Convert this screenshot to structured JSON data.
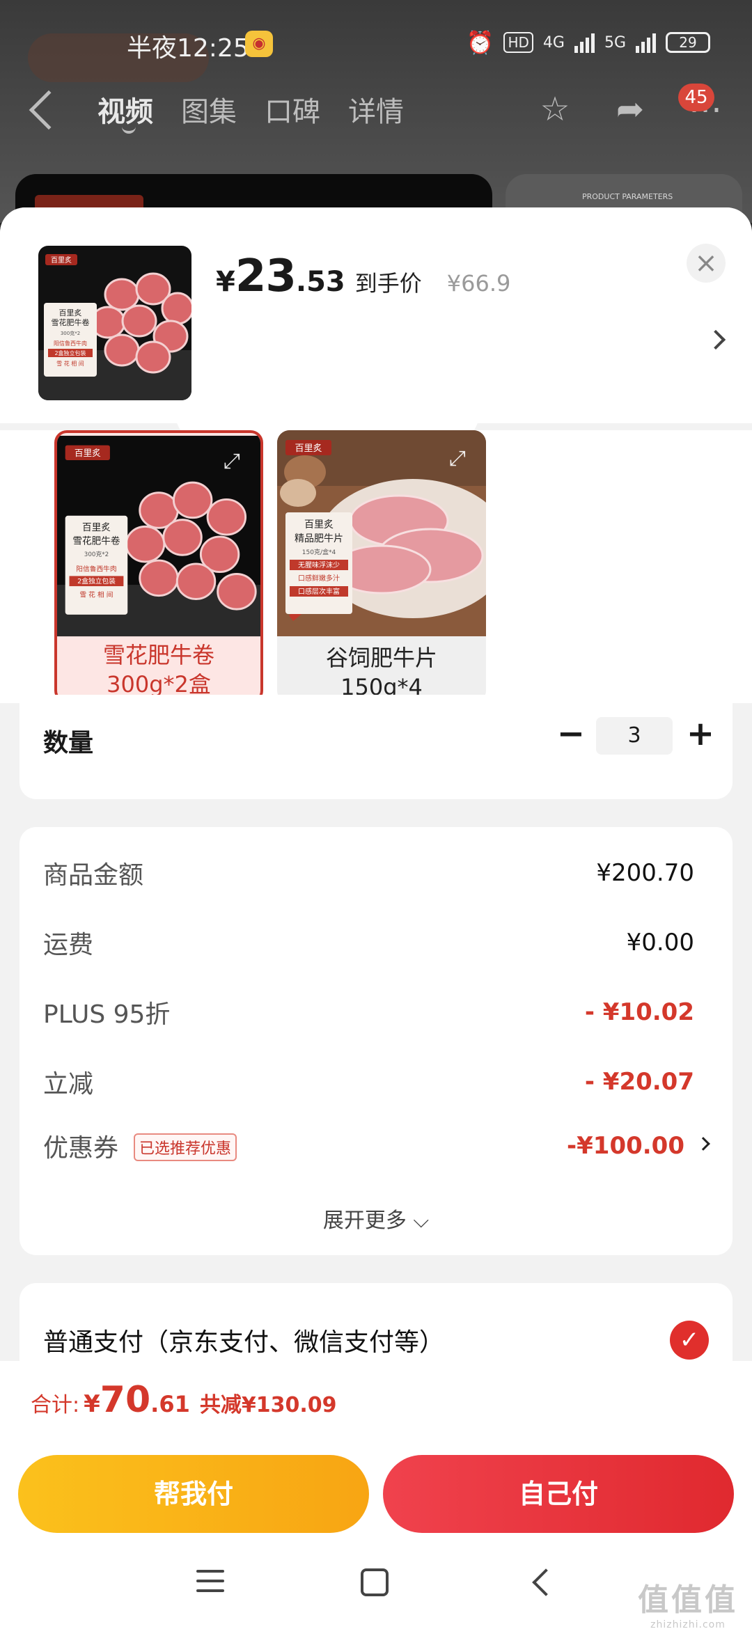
{
  "status_bar": {
    "time": "半夜12:25",
    "network_4g": "4G",
    "network_5g": "5G",
    "battery": "29",
    "hd": "HD"
  },
  "nav": {
    "tabs": [
      "视频",
      "图集",
      "口碑",
      "详情"
    ],
    "badge_count": "45"
  },
  "background": {
    "params_label": "PRODUCT PARAMETERS"
  },
  "sheet": {
    "price_symbol": "¥",
    "price_int": "23",
    "price_dec": ".53",
    "price_label": "到手价",
    "original_price": "¥66.9",
    "close_label": "×"
  },
  "thumbnail": {
    "brand": "百里炙",
    "name": "雪花肥牛卷",
    "spec": "300克*2",
    "tags": [
      "阳信鲁西牛肉",
      "2盒独立包装",
      "雪 花 相 间"
    ]
  },
  "variants": [
    {
      "line1": "雪花肥牛卷",
      "line2": "300g*2盒",
      "selected": true,
      "brand": "百里炙",
      "pack_name": "百里炙\n雪花肥牛卷",
      "pack_spec": "300克*2",
      "pack_tags": [
        "阳信鲁西牛肉",
        "2盒独立包装",
        "雪 花 相 间"
      ]
    },
    {
      "line1": "谷饲肥牛片",
      "line2": "150g*4",
      "selected": false,
      "brand": "百里炙",
      "pack_name": "百里炙\n精品肥牛片",
      "pack_spec": "150克/盒*4",
      "pack_tags": [
        "无腥味浮沫少",
        "口感鲜嫩多汁",
        "口感层次丰富"
      ]
    }
  ],
  "quantity": {
    "label": "数量",
    "value": "3",
    "minus": "−",
    "plus": "+"
  },
  "summary": {
    "rows": [
      {
        "label": "商品金额",
        "value": "¥200.70",
        "highlight": false
      },
      {
        "label": "运费",
        "value": "¥0.00",
        "highlight": false
      },
      {
        "label": "PLUS 95折",
        "value": "- ¥10.02",
        "highlight": true
      },
      {
        "label": "立减",
        "value": "- ¥20.07",
        "highlight": true
      }
    ],
    "coupon": {
      "label": "优惠券",
      "tag": "已选推荐优惠",
      "value": "-¥100.00"
    },
    "expand_more": "展开更多 ⌵"
  },
  "payment": {
    "label": "普通支付（京东支付、微信支付等）",
    "check": "✓"
  },
  "total": {
    "prefix": "合计:",
    "symbol": "¥",
    "int": "70",
    "dec": ".61",
    "saved": "共减¥130.09"
  },
  "buttons": {
    "help_pay": "帮我付",
    "self_pay": "自己付"
  },
  "watermark": {
    "main": "值值值",
    "sub": "zhizhizhi.com"
  },
  "colors": {
    "accent_red": "#d4382b",
    "pay_yellow": "#f8a513",
    "pay_red": "#e0292f"
  }
}
